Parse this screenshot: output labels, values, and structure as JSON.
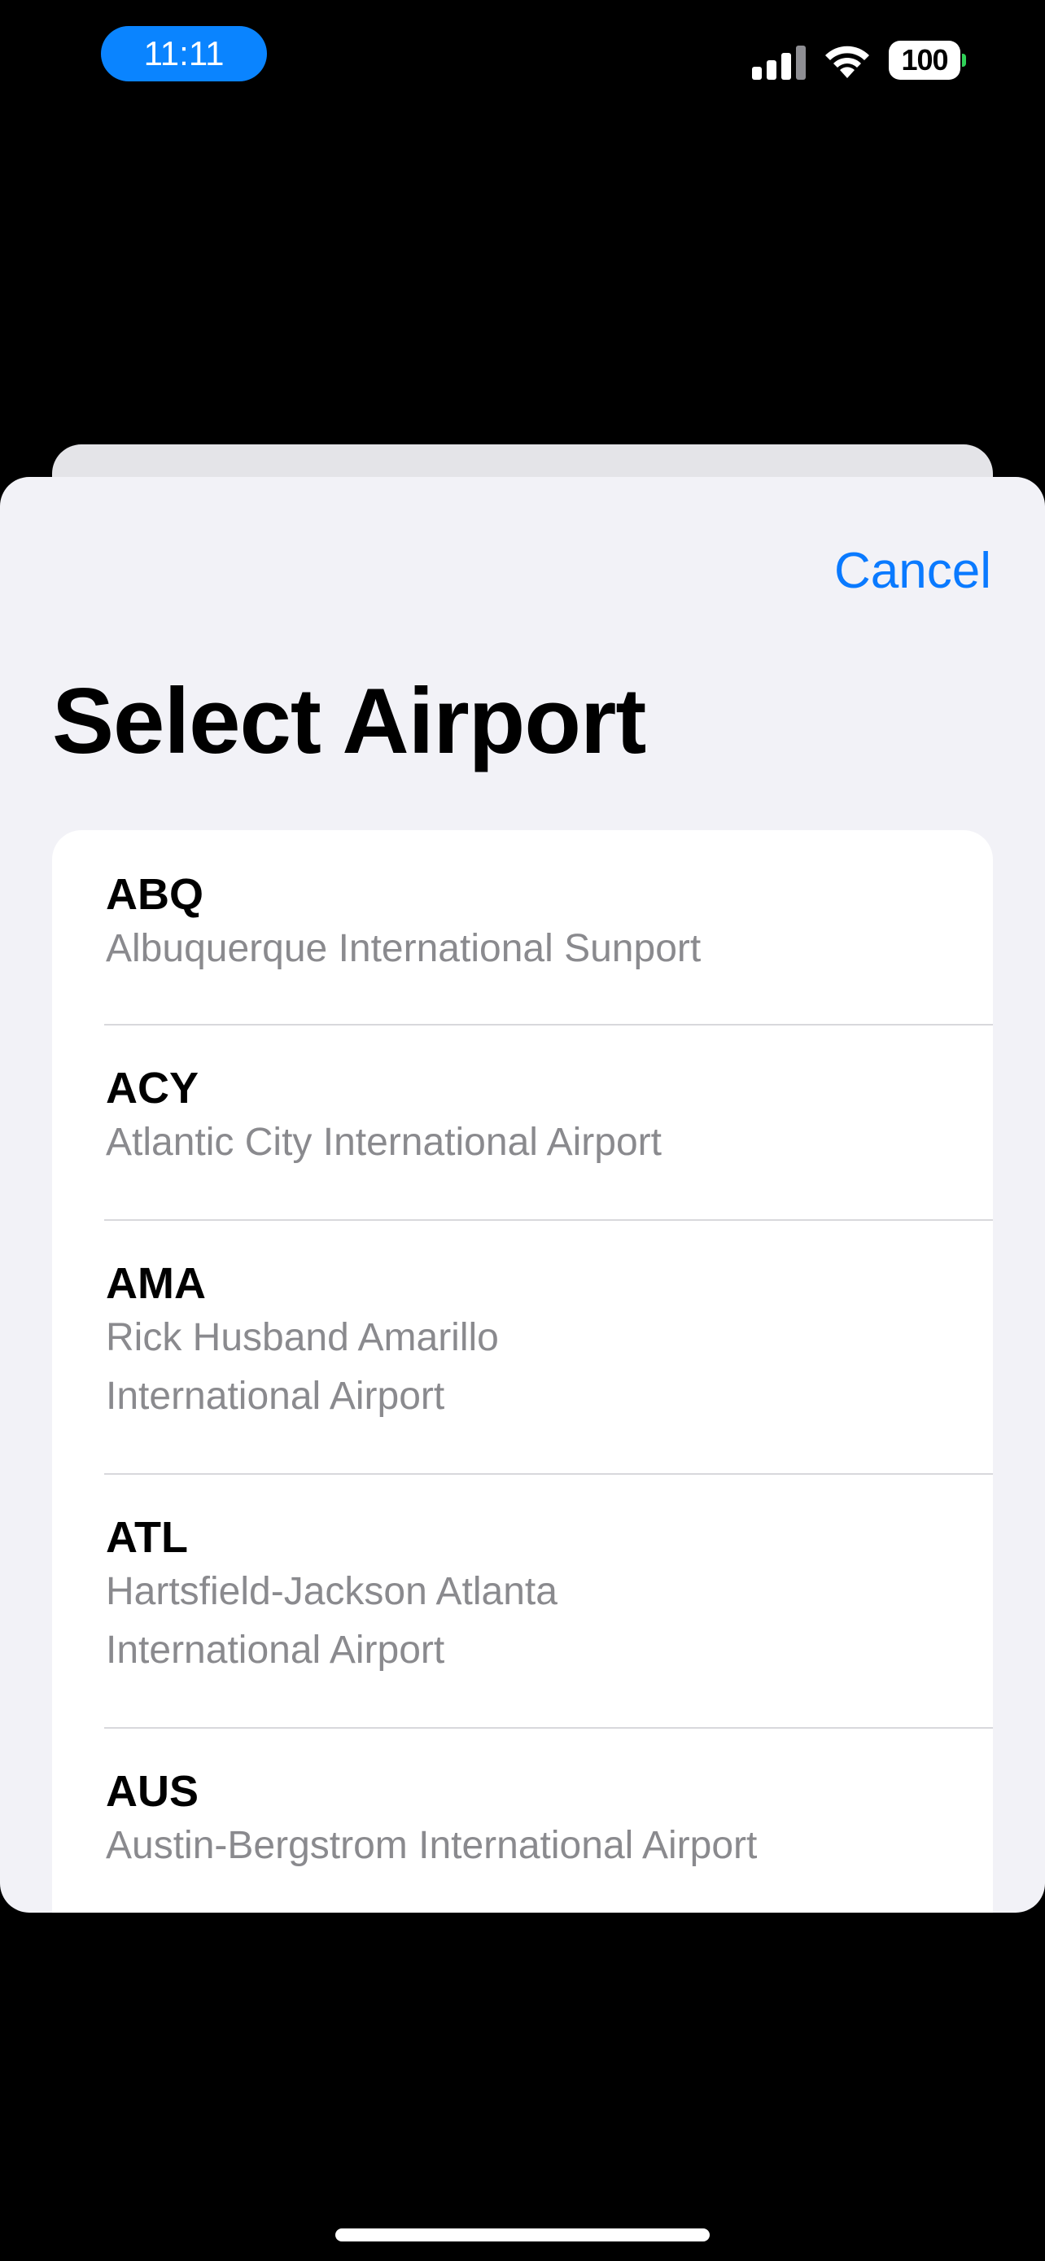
{
  "status_bar": {
    "time": "11:11",
    "battery": "100",
    "icons": [
      "signal-icon",
      "wifi-icon",
      "battery-icon"
    ]
  },
  "sheet": {
    "cancel_label": "Cancel",
    "title": "Select Airport"
  },
  "airports": [
    {
      "code": "ABQ",
      "name": "Albuquerque International Sunport"
    },
    {
      "code": "ACY",
      "name": "Atlantic City International Airport"
    },
    {
      "code": "AMA",
      "name": "Rick Husband Amarillo\nInternational Airport"
    },
    {
      "code": "ATL",
      "name": "Hartsfield-Jackson Atlanta\nInternational Airport"
    },
    {
      "code": "AUS",
      "name": "Austin-Bergstrom International Airport"
    }
  ],
  "colors": {
    "accent": "#0a7aff",
    "time_pill": "#0a84ff",
    "background": "#f2f2f7",
    "secondary_text": "#8a8a8e"
  }
}
